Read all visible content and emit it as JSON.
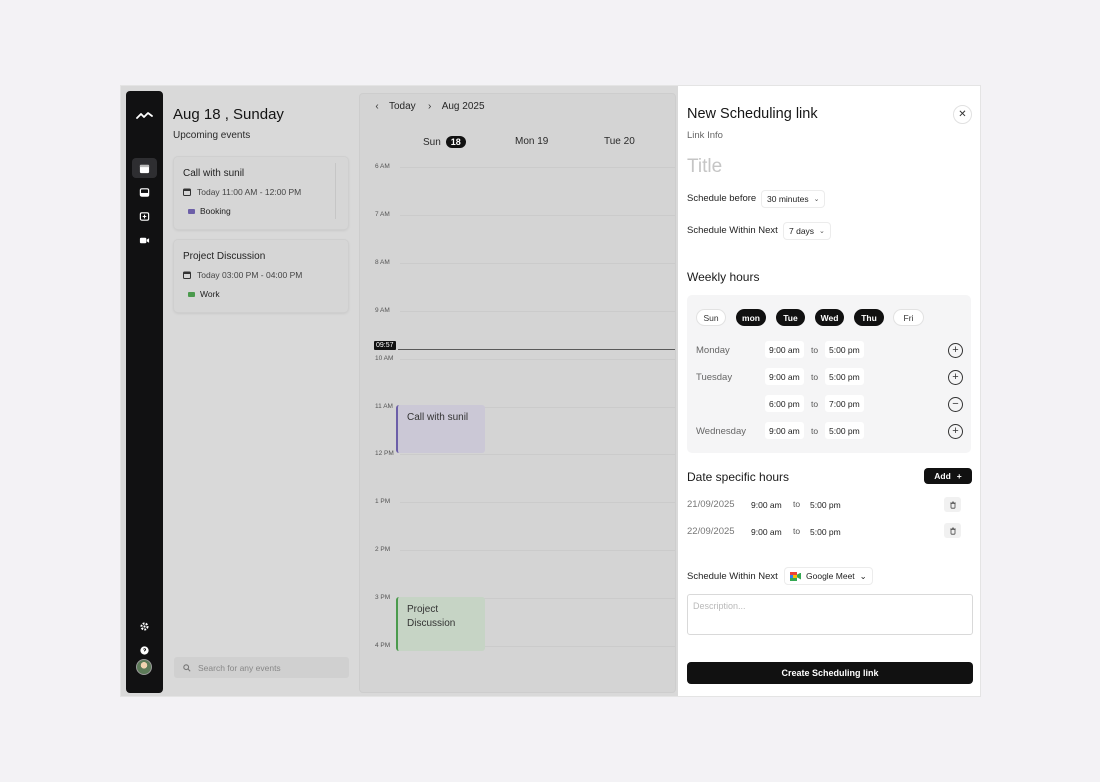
{
  "events_panel": {
    "date_title": "Aug 18 , Sunday",
    "upcoming_label": "Upcoming events",
    "events": [
      {
        "title": "Call with sunil",
        "time": "Today 11:00 AM - 12:00 PM",
        "tag": "Booking",
        "tag_color": "#6c5fa8"
      },
      {
        "title": "Project Discussion",
        "time": "Today 03:00 PM - 04:00 PM",
        "tag": "Work",
        "tag_color": "#4b9a4d"
      }
    ],
    "search_placeholder": "Search for any events"
  },
  "calendar": {
    "today_label": "Today",
    "month_label": "Aug 2025",
    "days": [
      {
        "name": "Sun",
        "num": "18"
      },
      {
        "name": "Mon 19"
      },
      {
        "name": "Tue 20"
      }
    ],
    "hours": [
      "6 AM",
      "7 AM",
      "8 AM",
      "9 AM",
      "10 AM",
      "11 AM",
      "12 PM",
      "1 PM",
      "2 PM",
      "3 PM",
      "4 PM"
    ],
    "now_time": "09:57",
    "events": [
      {
        "title": "Call with sunil"
      },
      {
        "title": "Project Discussion"
      }
    ]
  },
  "panel": {
    "heading": "New Scheduling link",
    "subheading": "Link Info",
    "title_placeholder": "Title",
    "schedule_before_label": "Schedule before",
    "schedule_before_value": "30 minutes",
    "schedule_within_label": "Schedule Within Next",
    "schedule_within_value": "7 days",
    "weekly_hours_label": "Weekly hours",
    "week_days": [
      {
        "label": "Sun",
        "on": false
      },
      {
        "label": "mon",
        "on": true
      },
      {
        "label": "Tue",
        "on": true
      },
      {
        "label": "Wed",
        "on": true
      },
      {
        "label": "Thu",
        "on": true
      },
      {
        "label": "Fri",
        "on": false
      }
    ],
    "to_label": "to",
    "weekly_rows": [
      {
        "day": "Monday",
        "from": "9:00 am",
        "to": "5:00 pm",
        "action": "+"
      },
      {
        "day": "Tuesday",
        "from": "9:00 am",
        "to": "5:00 pm",
        "action": "+"
      },
      {
        "day": "",
        "from": "6:00 pm",
        "to": "7:00 pm",
        "action": "−"
      },
      {
        "day": "Wednesday",
        "from": "9:00 am",
        "to": "5:00 pm",
        "action": "+"
      }
    ],
    "date_specific_label": "Date specific hours",
    "add_label": "Add",
    "date_rows": [
      {
        "date": "21/09/2025",
        "from": "9:00 am",
        "to": "5:00 pm"
      },
      {
        "date": "22/09/2025",
        "from": "9:00 am",
        "to": "5:00 pm"
      }
    ],
    "meeting_label": "Schedule Within Next",
    "meeting_value": "Google Meet",
    "description_placeholder": "Description...",
    "create_label": "Create Scheduling link"
  }
}
